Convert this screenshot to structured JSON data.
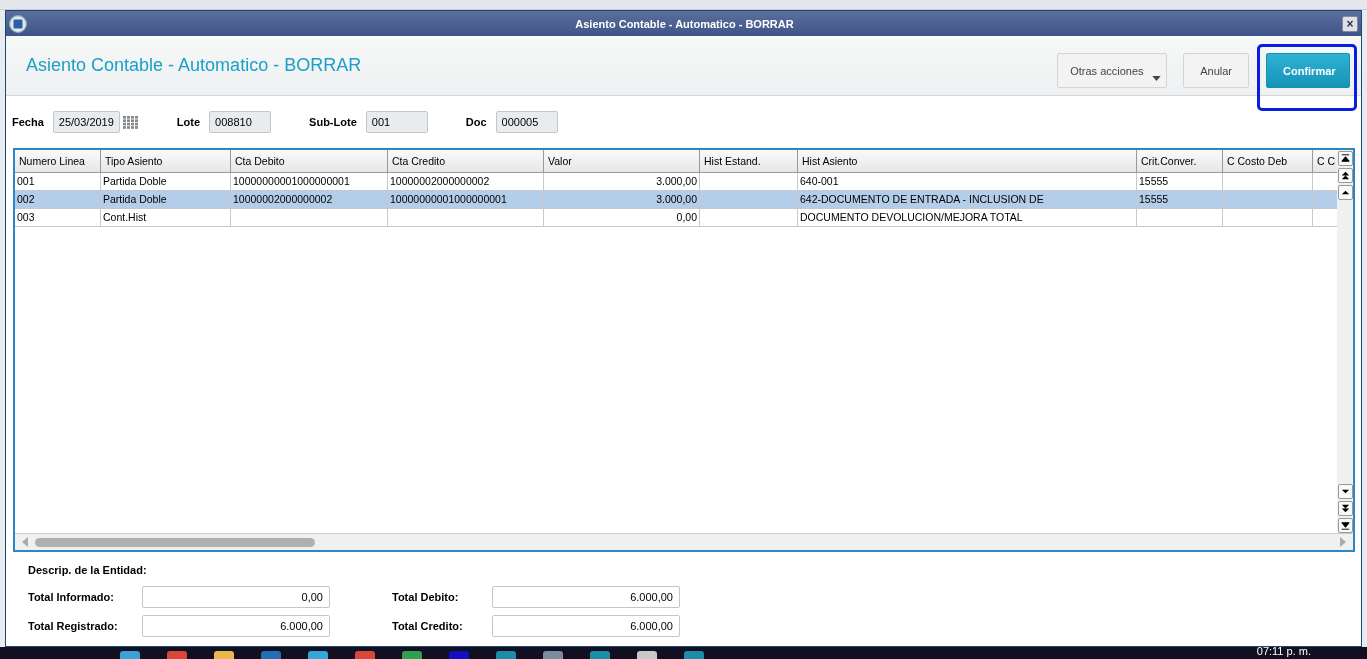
{
  "window": {
    "title": "Asiento Contable - Automatico - BORRAR",
    "close": "×"
  },
  "header": {
    "title": "Asiento Contable - Automatico - BORRAR",
    "buttons": [
      {
        "label": "Otras acciones",
        "kind": "menu",
        "highlighted": false
      },
      {
        "label": "Anular",
        "kind": "plain",
        "highlighted": false
      },
      {
        "label": "Confirmar",
        "kind": "primary",
        "highlighted": true
      }
    ]
  },
  "fields": [
    {
      "label": "Fecha",
      "value": "25/03/2019",
      "kind": "date"
    },
    {
      "label": "Lote",
      "value": "008810",
      "kind": "text"
    },
    {
      "label": "Sub-Lote",
      "value": "001",
      "kind": "text"
    },
    {
      "label": "Doc",
      "value": "000005",
      "kind": "text"
    }
  ],
  "table": {
    "columns": [
      {
        "label": "Numero Linea"
      },
      {
        "label": "Tipo Asiento"
      },
      {
        "label": "Cta Debito"
      },
      {
        "label": "Cta Credito"
      },
      {
        "label": "Valor"
      },
      {
        "label": "Hist Estand."
      },
      {
        "label": "Hist Asiento"
      },
      {
        "label": "Crit.Conver."
      },
      {
        "label": "C Costo Deb"
      },
      {
        "label": "C C"
      }
    ],
    "rows": [
      {
        "selected": false,
        "cells": [
          "001",
          "Partida Doble",
          "10000000001000000001",
          "10000002000000002",
          "3.000,00",
          "",
          "640-001",
          "15555",
          "",
          ""
        ]
      },
      {
        "selected": true,
        "cells": [
          "002",
          "Partida Doble",
          "10000002000000002",
          "10000000001000000001",
          "3.000,00",
          "",
          "642-DOCUMENTO DE ENTRADA - INCLUSION DE",
          "15555",
          "",
          ""
        ]
      },
      {
        "selected": false,
        "cells": [
          "003",
          "Cont.Hist",
          "",
          "",
          "0,00",
          "",
          "DOCUMENTO DEVOLUCION/MEJORA TOTAL",
          "",
          "",
          ""
        ]
      }
    ]
  },
  "entity_label": "Descrip. de la Entidad:",
  "totals": [
    {
      "label": "Total Informado:",
      "value": "0,00"
    },
    {
      "label": "Total Debito:",
      "value": "6.000,00"
    },
    {
      "label": "Total Registrado:",
      "value": "6.000,00"
    },
    {
      "label": "Total Credito:",
      "value": "6.000,00"
    }
  ],
  "taskbar": {
    "clock": "07:11 p. m."
  }
}
